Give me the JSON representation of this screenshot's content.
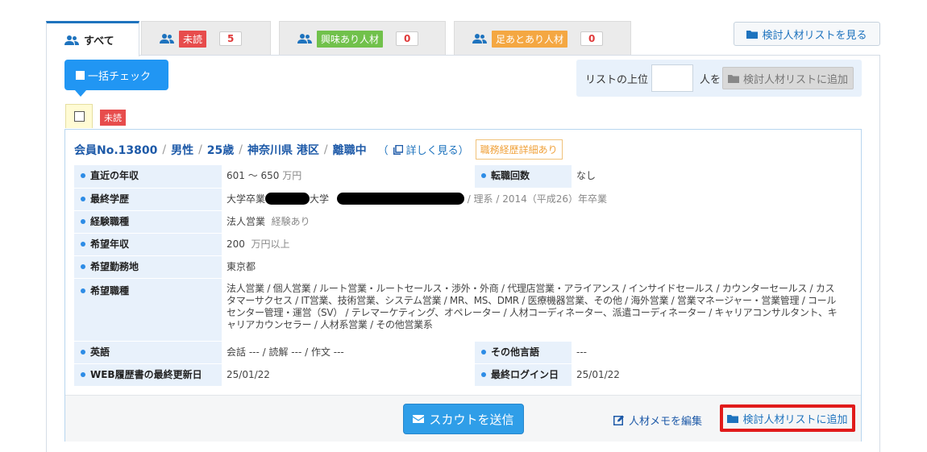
{
  "tabs": [
    {
      "label": "すべて",
      "active": true
    },
    {
      "tag": "未読",
      "count": "5"
    },
    {
      "tag": "興味あり人材",
      "count": "0"
    },
    {
      "tag": "足あとあり人材",
      "count": "0"
    }
  ],
  "top_button": "検討人材リストを見る",
  "bulk_check": "一括チェック",
  "list_bar": {
    "prefix": "リストの上位",
    "suffix": "人を",
    "add_button": "検討人材リストに追加",
    "input_value": ""
  },
  "unread_badge": "未読",
  "member": {
    "id": "会員No.13800",
    "gender": "男性",
    "age": "25歳",
    "location": "神奈川県 港区",
    "status": "離職中",
    "detail_link": "詳しく見る",
    "detail_open": "（",
    "detail_close": "）",
    "work_badge": "職務経歴詳細あり",
    "separator": "/"
  },
  "info": {
    "income_label": "直近の年収",
    "income_value": "601 ～ 650",
    "income_unit": "万円",
    "job_changes_label": "転職回数",
    "job_changes_value": "なし",
    "education_label": "最終学歴",
    "education_prefix": "大学卒業",
    "education_mid": "大学",
    "education_suffix": "/ 理系 / 2014（平成26）年卒業",
    "experience_label": "経験職種",
    "experience_value": "法人営業",
    "experience_note": "経験あり",
    "desired_income_label": "希望年収",
    "desired_income_value": "200",
    "desired_income_unit": "万円以上",
    "desired_location_label": "希望勤務地",
    "desired_location_value": "東京都",
    "desired_jobs_label": "希望職種",
    "desired_jobs_value": "法人営業 / 個人営業 / ルート営業・ルートセールス・渉外・外商 / 代理店営業・アライアンス / インサイドセールス / カウンターセールス / カスタマーサクセス / IT営業、技術営業、システム営業 / MR、MS、DMR / 医療機器営業、その他 / 海外営業 / 営業マネージャー・営業管理 / コールセンター管理・運営（SV） / テレマーケティング、オペレーター / 人材コーディネーター、派遣コーディネーター / キャリアコンサルタント、キャリアカウンセラー / 人材系営業 / その他営業系",
    "english_label": "英語",
    "english_value": "会話 --- / 読解 --- / 作文 ---",
    "other_lang_label": "その他言語",
    "other_lang_value": "---",
    "resume_updated_label": "WEB履歴書の最終更新日",
    "resume_updated_value": "25/01/22",
    "last_login_label": "最終ログイン日",
    "last_login_value": "25/01/22"
  },
  "footer": {
    "scout_button": "スカウトを送信",
    "memo_link": "人材メモを編集",
    "add_list_button": "検討人材リストに追加"
  },
  "colors": {
    "primary": "#2196f3",
    "tag_unread": "#e74c4c",
    "tag_interest": "#71c14b",
    "tag_footprint": "#f4a742",
    "highlight_border": "#e11b1b"
  }
}
